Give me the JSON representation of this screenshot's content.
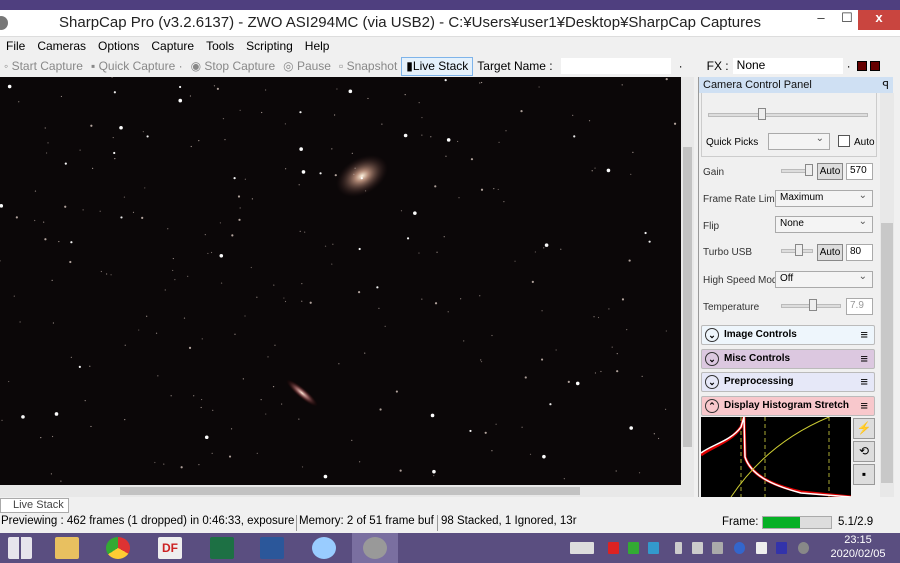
{
  "window": {
    "title": "SharpCap Pro (v3.2.6137) - ZWO ASI294MC (via USB2) - C:¥Users¥user1¥Desktop¥SharpCap Captures",
    "minimize": "–",
    "maximize": "☐",
    "close": "x"
  },
  "menu": [
    "File",
    "Cameras",
    "Options",
    "Capture",
    "Tools",
    "Scripting",
    "Help"
  ],
  "toolbar": {
    "start_capture": "Start Capture",
    "quick_capture": "Quick Capture",
    "stop_capture": "Stop Capture",
    "pause": "Pause",
    "snapshot": "Snapshot",
    "live_stack": "Live Stack",
    "target_label": "Target Name :",
    "target_value": "",
    "fx_label": "FX :",
    "fx_value": "None"
  },
  "panel": {
    "title": "Camera Control Panel",
    "quick_picks_label": "Quick Picks",
    "auto_label": "Auto",
    "gain": {
      "label": "Gain",
      "auto": "Auto",
      "value": "570"
    },
    "frame_rate": {
      "label": "Frame Rate Limit",
      "value": "Maximum"
    },
    "flip": {
      "label": "Flip",
      "value": "None"
    },
    "turbo_usb": {
      "label": "Turbo USB",
      "auto": "Auto",
      "value": "80"
    },
    "high_speed": {
      "label": "High Speed Mode",
      "value": "Off"
    },
    "temperature": {
      "label": "Temperature",
      "value": "7.9"
    },
    "groups": [
      {
        "label": "Image Controls",
        "color": "#eef6fc"
      },
      {
        "label": "Misc Controls",
        "color": "#dcc8e0"
      },
      {
        "label": "Preprocessing",
        "color": "#e6e8f8"
      },
      {
        "label": "Display Histogram Stretch",
        "color": "#f8c8cc"
      }
    ]
  },
  "tab": {
    "live_stack": "Live Stack"
  },
  "status": {
    "preview": "Previewing : 462 frames (1 dropped) in 0:46:33, exposure",
    "memory": "Memory: 2 of 51 frame buf",
    "stack": "98 Stacked, 1 Ignored, 13r",
    "frame_label": "Frame:",
    "frame_fill": 0.55,
    "frame_value": "5.1/2.9"
  },
  "taskbar": {
    "time": "23:15",
    "date": "2020/02/05"
  }
}
